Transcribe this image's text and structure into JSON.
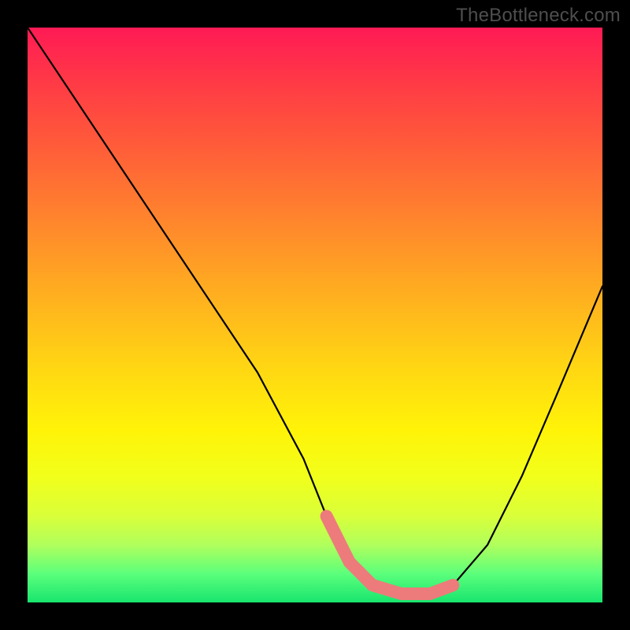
{
  "watermark": "TheBottleneck.com",
  "chart_data": {
    "type": "line",
    "title": "",
    "xlabel": "",
    "ylabel": "",
    "xlim": [
      0,
      100
    ],
    "ylim": [
      0,
      100
    ],
    "series": [
      {
        "name": "bottleneck-curve",
        "x": [
          0,
          10,
          20,
          30,
          40,
          48,
          52,
          56,
          60,
          65,
          70,
          74,
          80,
          86,
          92,
          100
        ],
        "y": [
          100,
          85,
          70,
          55,
          40,
          25,
          15,
          7,
          3,
          1.5,
          1.5,
          3,
          10,
          22,
          36,
          55
        ]
      }
    ],
    "highlight": {
      "name": "optimal-zone",
      "color": "#ed7b7b",
      "x": [
        52,
        56,
        60,
        65,
        70,
        74
      ],
      "y": [
        15,
        7,
        3,
        1.5,
        1.5,
        3
      ]
    },
    "gradient_background": true
  }
}
